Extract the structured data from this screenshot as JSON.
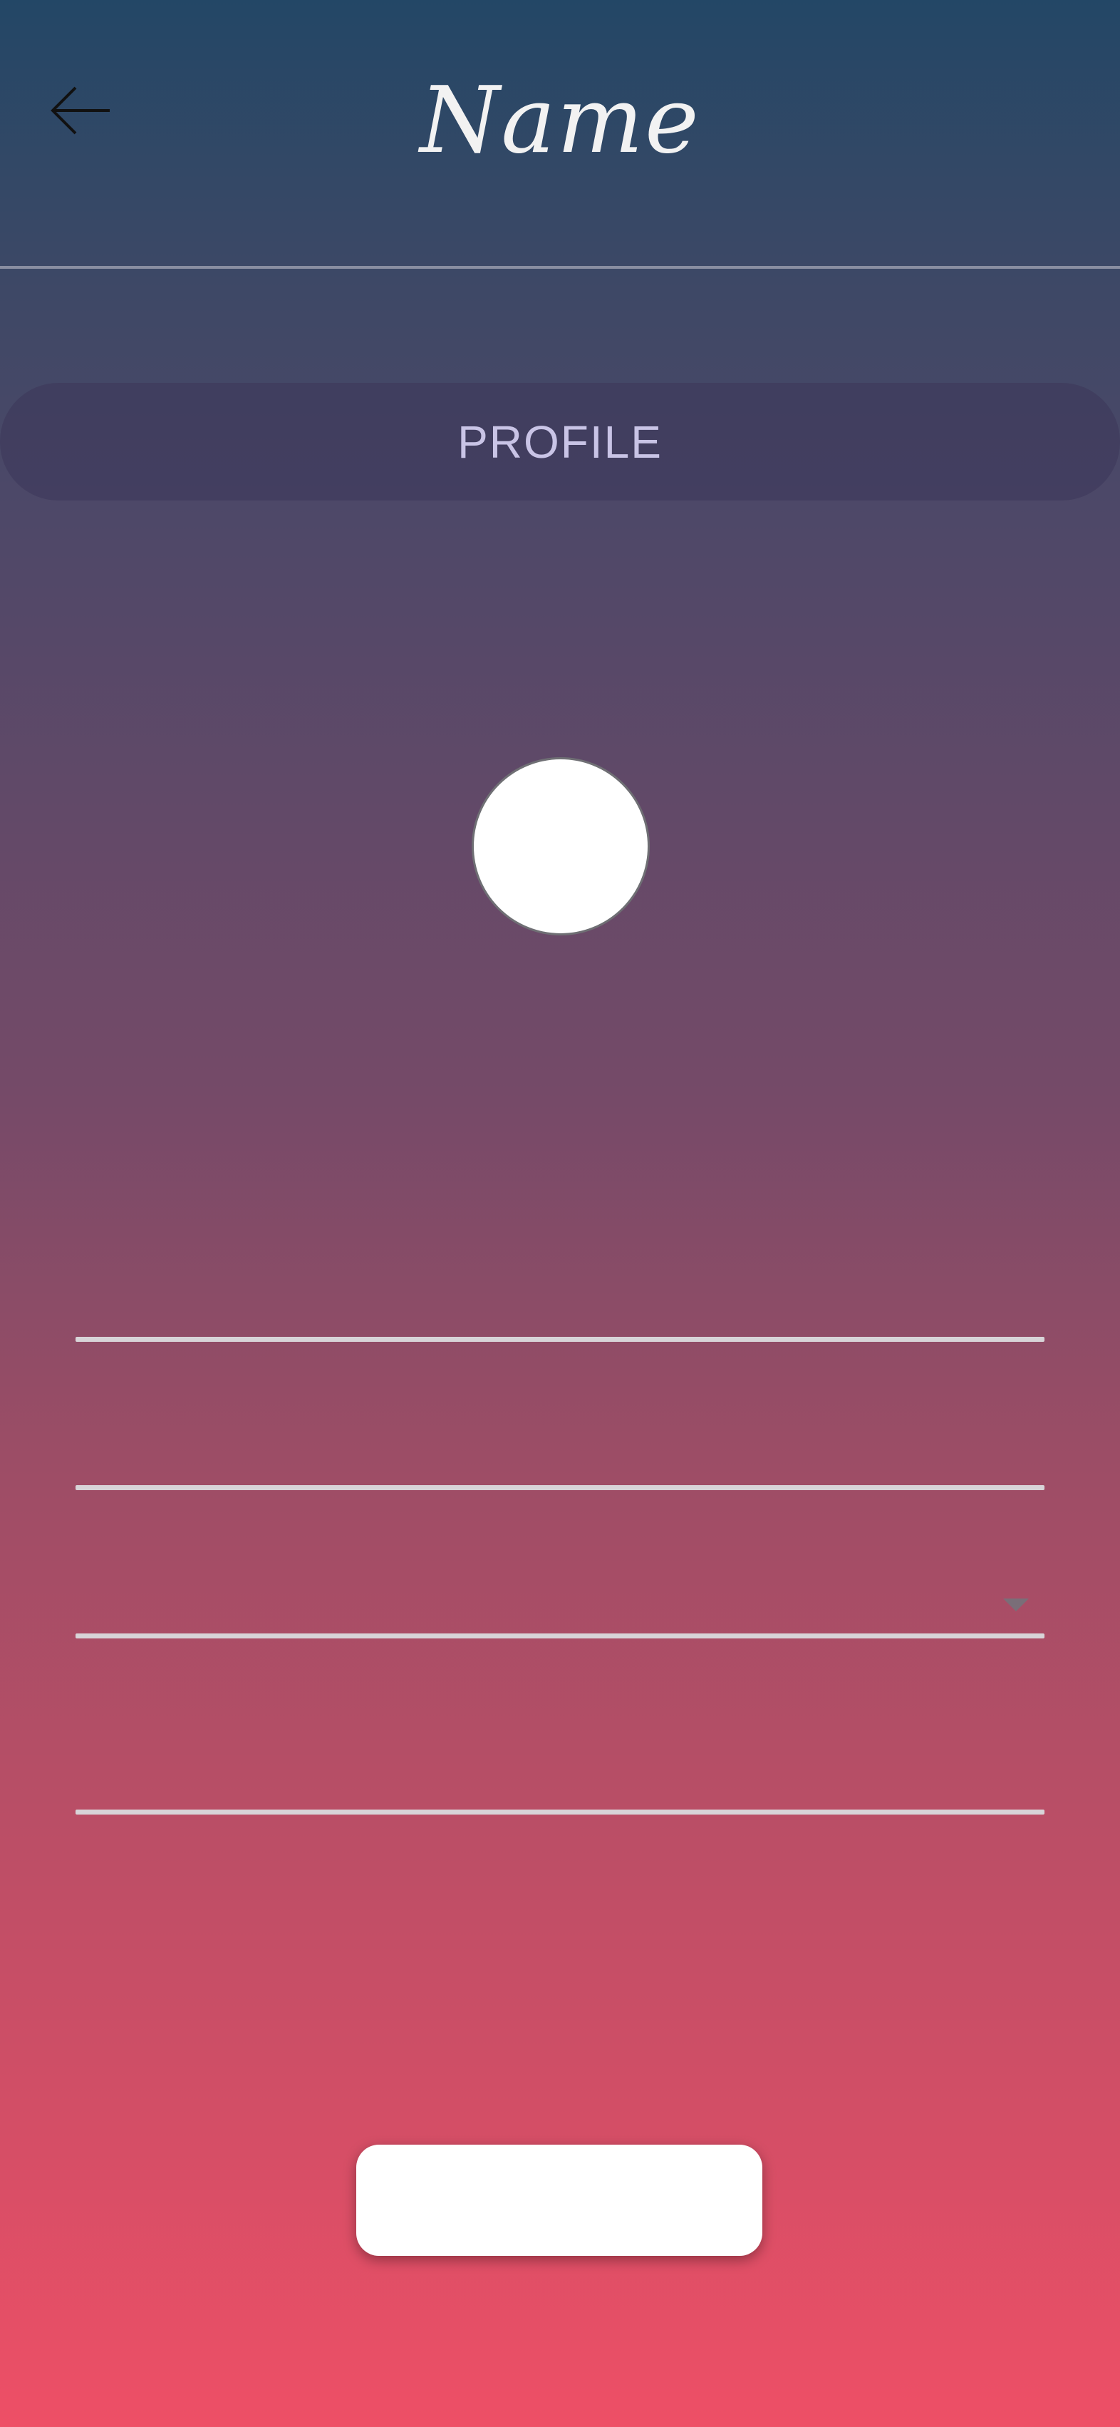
{
  "header": {
    "title": "Name",
    "back_icon": "arrow-left-icon"
  },
  "tabs": {
    "profile_label": "PROFILE"
  },
  "avatar": {
    "icon": "avatar-placeholder"
  },
  "form": {
    "fields": [
      {
        "value": ""
      },
      {
        "value": ""
      },
      {
        "value": "",
        "icon": "caret-down-icon"
      },
      {
        "value": ""
      }
    ]
  },
  "actions": {
    "submit_label": ""
  },
  "colors": {
    "gradient_top": "#234766",
    "gradient_bottom": "#ee4f66",
    "title_text": "#f2f2f2",
    "tab_text": "#c9c4e6",
    "field_line": "#d8d4d8"
  }
}
